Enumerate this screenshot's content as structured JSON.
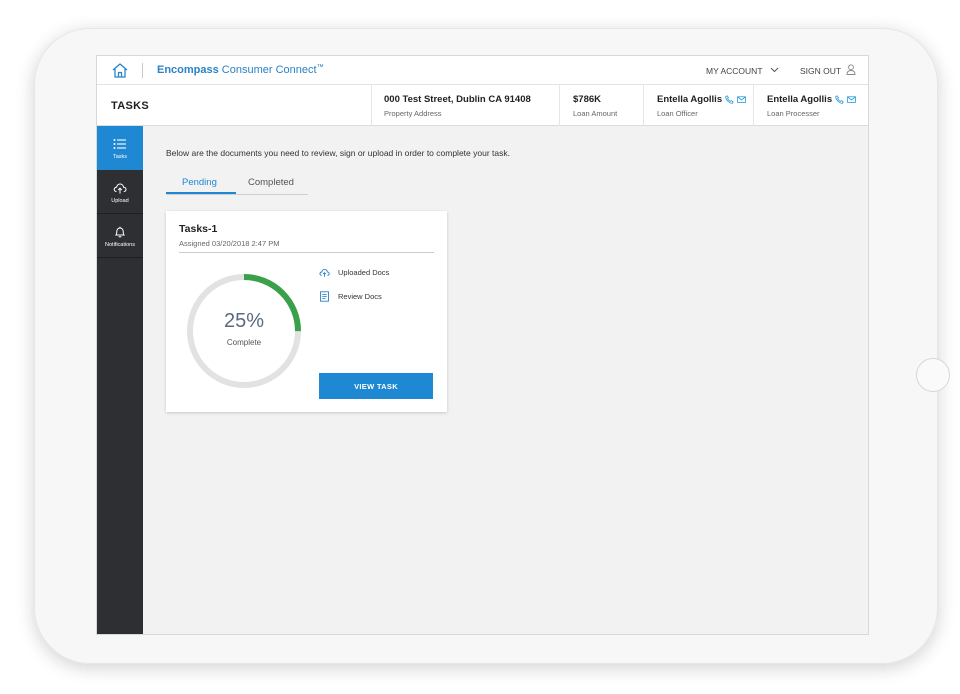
{
  "brand": {
    "bold": "Encompass",
    "rest": " Consumer Connect",
    "tm": "™"
  },
  "topnav": {
    "my_account": "MY ACCOUNT",
    "sign_out": "SIGN OUT"
  },
  "header": {
    "page_title": "TASKS",
    "property": {
      "value": "000 Test Street, Dublin CA 91408",
      "label": "Property Address"
    },
    "loan_amount": {
      "value": "$786K",
      "label": "Loan Amount"
    },
    "loan_officer": {
      "value": "Entella Agollis",
      "label": "Loan Officer"
    },
    "loan_processor": {
      "value": "Entella Agollis",
      "label": "Loan Processer"
    }
  },
  "sidebar": {
    "items": [
      {
        "label": "Tasks",
        "icon": "list-icon",
        "active": true
      },
      {
        "label": "Upload",
        "icon": "cloud-upload-icon",
        "active": false
      },
      {
        "label": "Notifications",
        "icon": "bell-icon",
        "active": false
      }
    ]
  },
  "main": {
    "intro": "Below are the documents you need to review, sign or upload in order to complete your task.",
    "tabs": [
      {
        "label": "Pending",
        "active": true
      },
      {
        "label": "Completed",
        "active": false
      }
    ],
    "task_card": {
      "title": "Tasks-1",
      "assigned": "Assigned 03/20/2018 2:47 PM",
      "progress_percent": 25,
      "progress_text": "25%",
      "progress_label": "Complete",
      "docs": [
        {
          "label": "Uploaded Docs",
          "icon": "cloud-upload-icon"
        },
        {
          "label": "Review Docs",
          "icon": "document-icon"
        }
      ],
      "button": "VIEW TASK"
    }
  },
  "colors": {
    "accent": "#1e88d2",
    "progress": "#3aa04a",
    "track": "#e2e2e2",
    "sidebar": "#2d2f33"
  }
}
